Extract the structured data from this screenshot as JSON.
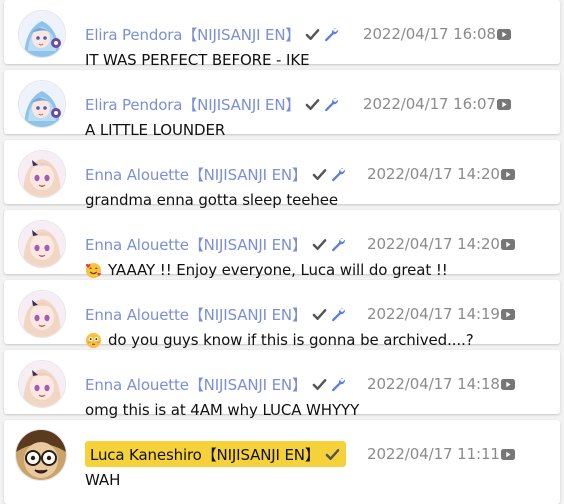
{
  "messages": [
    {
      "author": "Elira Pendora【NIJISANJI EN】",
      "timestamp": "2022/04/17 16:08",
      "text": "IT WAS PERFECT BEFORE - IKE",
      "avatar": "elira-avatar",
      "badges": [
        "check-icon",
        "wrench-icon"
      ],
      "emoji": null
    },
    {
      "author": "Elira Pendora【NIJISANJI EN】",
      "timestamp": "2022/04/17 16:07",
      "text": "A LITTLE LOUNDER",
      "avatar": "elira-avatar",
      "badges": [
        "check-icon",
        "wrench-icon"
      ],
      "emoji": null
    },
    {
      "author": "Enna Alouette【NIJISANJI EN】",
      "timestamp": "2022/04/17 14:20",
      "text": "grandma enna gotta sleep teehee",
      "avatar": "enna-avatar",
      "badges": [
        "check-icon",
        "wrench-icon"
      ],
      "emoji": null
    },
    {
      "author": "Enna Alouette【NIJISANJI EN】",
      "timestamp": "2022/04/17 14:20",
      "text": "YAAAY !! Enjoy everyone, Luca will do great !!",
      "avatar": "enna-avatar",
      "badges": [
        "check-icon",
        "wrench-icon"
      ],
      "emoji": "smiling-face-with-hearts-emoji"
    },
    {
      "author": "Enna Alouette【NIJISANJI EN】",
      "timestamp": "2022/04/17 14:19",
      "text": "do you guys know if this is gonna be archived....?",
      "avatar": "enna-avatar",
      "badges": [
        "check-icon",
        "wrench-icon"
      ],
      "emoji": "flushed-face-emoji"
    },
    {
      "author": "Enna Alouette【NIJISANJI EN】",
      "timestamp": "2022/04/17 14:18",
      "text": "omg this is at 4AM why LUCA WHYYY",
      "avatar": "enna-avatar",
      "badges": [
        "check-icon",
        "wrench-icon"
      ],
      "emoji": null
    },
    {
      "author": "Luca Kaneshiro【NIJISANJI EN】",
      "timestamp": "2022/04/17 11:11",
      "text": "WAH",
      "avatar": "luca-avatar",
      "badges": [
        "check-icon"
      ],
      "emoji": null,
      "owner": true
    }
  ],
  "colors": {
    "name": "#7b8fd6",
    "owner_highlight": "#f6d23a",
    "timestamp": "#8b8b8b",
    "badge": "#555555",
    "wrench": "#5b7fe0",
    "youtube_icon": "#777777"
  }
}
